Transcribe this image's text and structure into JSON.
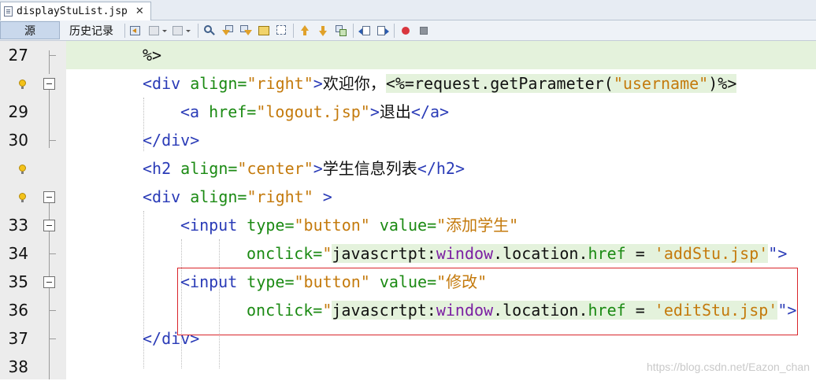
{
  "tab": {
    "filename": "displayStuList.jsp",
    "close_glyph": "✕"
  },
  "toolbar": {
    "source_label": "源",
    "history_label": "历史记录"
  },
  "lines": [
    {
      "num": "27",
      "marker": "none"
    },
    {
      "num": "",
      "marker": "bulb"
    },
    {
      "num": "29",
      "marker": "none"
    },
    {
      "num": "30",
      "marker": "none"
    },
    {
      "num": "",
      "marker": "bulb"
    },
    {
      "num": "",
      "marker": "bulb"
    },
    {
      "num": "33",
      "marker": "none"
    },
    {
      "num": "34",
      "marker": "none"
    },
    {
      "num": "35",
      "marker": "none"
    },
    {
      "num": "36",
      "marker": "none"
    },
    {
      "num": "37",
      "marker": "none"
    },
    {
      "num": "38",
      "marker": "none"
    }
  ],
  "code": {
    "l27": "%>",
    "l28": {
      "open": "<div ",
      "attr": "align=",
      "val": "\"right\"",
      "close": ">",
      "text": "欢迎你，",
      "expr_open": "<%=",
      "expr_mid": "request.getParameter(",
      "expr_str": "\"username\"",
      "expr_end": ")%>"
    },
    "l29": {
      "open": "<a ",
      "attr": "href=",
      "val": "\"logout.jsp\"",
      "close": ">",
      "text": "退出",
      "end": "</a>"
    },
    "l30": "</div>",
    "l31": {
      "open": "<h2 ",
      "attr": "align=",
      "val": "\"center\"",
      "close": ">",
      "text": "学生信息列表",
      "end": "</h2>"
    },
    "l32": {
      "open": "<div ",
      "attr": "align=",
      "val": "\"right\"",
      "close": " >"
    },
    "l33": {
      "open": "<input ",
      "attr1": "type=",
      "val1": "\"button\"",
      "attr2": " value=",
      "val2": "\"添加学生\""
    },
    "l34": {
      "attr": "onclick=",
      "q": "\"",
      "js1": "javascrtpt:",
      "js2": "window",
      "js3": ".location.",
      "js4": "href",
      "js5": " = ",
      "str": "'addStu.jsp'",
      "close": "\">"
    },
    "l35": {
      "open": "<input ",
      "attr1": "type=",
      "val1": "\"button\"",
      "attr2": " value=",
      "val2": "\"修改\""
    },
    "l36": {
      "attr": "onclick=",
      "q": "\"",
      "js1": "javascrtpt:",
      "js2": "window",
      "js3": ".location.",
      "js4": "href",
      "js5": " = ",
      "str": "'editStu.jsp'",
      "close": "\">"
    },
    "l37": "</div>"
  },
  "watermark": "https://blog.csdn.net/Eazon_chan",
  "colors": {
    "tag": "#2a3bb7",
    "attr": "#1b8a13",
    "value": "#c47a0c",
    "highlight": "#e4f2dc",
    "annotation": "#d9252b"
  },
  "icons": [
    "back-icon",
    "forward-icon",
    "find-icon",
    "find-prev-icon",
    "find-next-icon",
    "toggle-highlight-icon",
    "toggle-rect-icon",
    "prev-bookmark-icon",
    "next-bookmark-icon",
    "toggle-bookmark-icon",
    "shift-left-icon",
    "shift-right-icon",
    "record-macro-icon",
    "stop-macro-icon"
  ]
}
